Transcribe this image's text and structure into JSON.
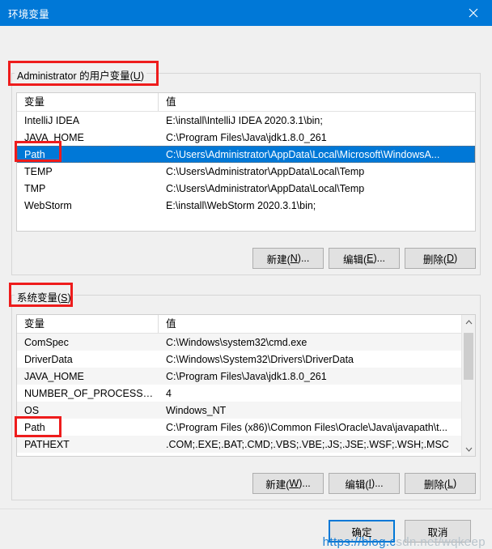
{
  "window": {
    "title": "环境变量",
    "close_icon": "close-icon"
  },
  "user_section": {
    "label_prefix": "Administrator 的用户变量(",
    "label_accel": "U",
    "label_suffix": ")",
    "columns": {
      "name": "变量",
      "value": "值"
    },
    "rows": [
      {
        "name": "IntelliJ IDEA",
        "value": "E:\\install\\IntelliJ IDEA 2020.3.1\\bin;",
        "selected": false
      },
      {
        "name": "JAVA_HOME",
        "value": "C:\\Program Files\\Java\\jdk1.8.0_261",
        "selected": false
      },
      {
        "name": "Path",
        "value": "C:\\Users\\Administrator\\AppData\\Local\\Microsoft\\WindowsA...",
        "selected": true
      },
      {
        "name": "TEMP",
        "value": "C:\\Users\\Administrator\\AppData\\Local\\Temp",
        "selected": false
      },
      {
        "name": "TMP",
        "value": "C:\\Users\\Administrator\\AppData\\Local\\Temp",
        "selected": false
      },
      {
        "name": "WebStorm",
        "value": "E:\\install\\WebStorm 2020.3.1\\bin;",
        "selected": false
      }
    ],
    "buttons": [
      {
        "prefix": "新建(",
        "accel": "N",
        "suffix": ")..."
      },
      {
        "prefix": "编辑(",
        "accel": "E",
        "suffix": ")..."
      },
      {
        "prefix": "删除(",
        "accel": "D",
        "suffix": ")"
      }
    ]
  },
  "system_section": {
    "label_prefix": "系统变量(",
    "label_accel": "S",
    "label_suffix": ")",
    "columns": {
      "name": "变量",
      "value": "值"
    },
    "rows": [
      {
        "name": "ComSpec",
        "value": "C:\\Windows\\system32\\cmd.exe"
      },
      {
        "name": "DriverData",
        "value": "C:\\Windows\\System32\\Drivers\\DriverData"
      },
      {
        "name": "JAVA_HOME",
        "value": "C:\\Program Files\\Java\\jdk1.8.0_261"
      },
      {
        "name": "NUMBER_OF_PROCESSORS",
        "value": "4"
      },
      {
        "name": "OS",
        "value": "Windows_NT"
      },
      {
        "name": "Path",
        "value": "C:\\Program Files (x86)\\Common Files\\Oracle\\Java\\javapath\\t..."
      },
      {
        "name": "PATHEXT",
        "value": ".COM;.EXE;.BAT;.CMD;.VBS;.VBE;.JS;.JSE;.WSF;.WSH;.MSC"
      }
    ],
    "buttons": [
      {
        "prefix": "新建(",
        "accel": "W",
        "suffix": ")..."
      },
      {
        "prefix": "编辑(",
        "accel": "I",
        "suffix": ")..."
      },
      {
        "prefix": "删除(",
        "accel": "L",
        "suffix": ")"
      }
    ],
    "scrollbar": {
      "up_arrow": "chevron-up-icon",
      "down_arrow": "chevron-down-icon"
    }
  },
  "footer": {
    "ok_label": "确定",
    "cancel_label": "取消"
  },
  "watermark": {
    "text_highlight": "https://blog.c",
    "text_rest": "sdn.net/wqkeep"
  },
  "colors": {
    "titlebar": "#0078d7",
    "selection": "#0078d7",
    "annotation_red": "#ee1c1c",
    "dialog_bg": "#f0f0f0"
  }
}
